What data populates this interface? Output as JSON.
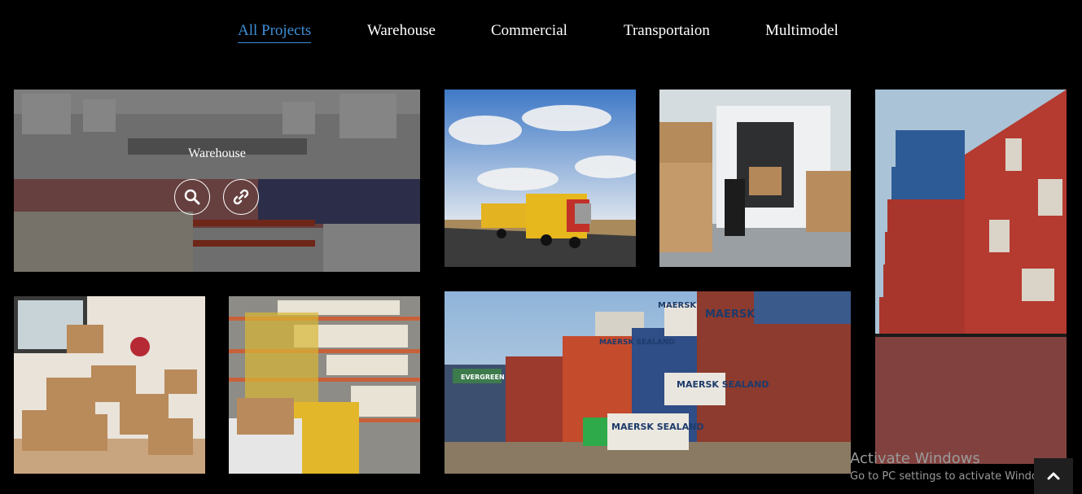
{
  "filter_tabs": [
    {
      "label": "All Projects",
      "active": true
    },
    {
      "label": "Warehouse",
      "active": false
    },
    {
      "label": "Commercial",
      "active": false
    },
    {
      "label": "Transportaion",
      "active": false
    },
    {
      "label": "Multimodel",
      "active": false
    }
  ],
  "gallery": {
    "hover_tile": {
      "title": "Warehouse",
      "buttons": [
        "search-icon",
        "link-icon"
      ]
    },
    "images": [
      {
        "subject": "warehouse-interior"
      },
      {
        "subject": "road-train-truck"
      },
      {
        "subject": "delivery-van-boxes"
      },
      {
        "subject": "container-stack-tall"
      },
      {
        "subject": "moving-boxes-room"
      },
      {
        "subject": "warehouse-shelves-forklift"
      },
      {
        "subject": "shipping-containers-yard",
        "labels": [
          "MAERSK",
          "MAERSK",
          "MAERSK SEALAND",
          "MAERSK SEALAND",
          "MAERSK SEALAND",
          "EVERGREEN"
        ]
      }
    ]
  },
  "watermark": {
    "title": "Activate Windows",
    "subtitle": "Go to PC settings to activate Windows."
  },
  "scroll_top": {
    "icon": "chevron-up-icon"
  }
}
